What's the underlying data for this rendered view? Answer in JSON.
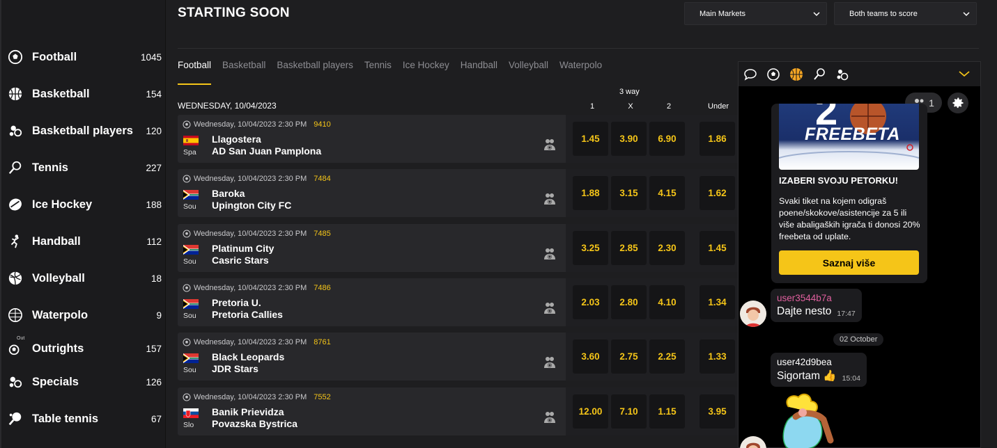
{
  "page": {
    "title": "STARTING SOON"
  },
  "dropdowns": {
    "markets": "Main Markets",
    "submarket": "Both teams to score"
  },
  "sidebar": {
    "items": [
      {
        "label": "Football",
        "count": "1045",
        "icon": "soccer-ball-icon"
      },
      {
        "label": "Basketball",
        "count": "154",
        "icon": "basketball-icon"
      },
      {
        "label": "Basketball players",
        "count": "120",
        "icon": "basketball-players-icon"
      },
      {
        "label": "Tennis",
        "count": "227",
        "icon": "tennis-racket-icon"
      },
      {
        "label": "Ice Hockey",
        "count": "188",
        "icon": "hockey-puck-icon"
      },
      {
        "label": "Handball",
        "count": "112",
        "icon": "handball-player-icon"
      },
      {
        "label": "Volleyball",
        "count": "18",
        "icon": "volleyball-icon"
      },
      {
        "label": "Waterpolo",
        "count": "9",
        "icon": "waterpolo-ball-icon"
      },
      {
        "label": "Outrights",
        "count": "157",
        "icon": "outrights-icon",
        "badge": "Out"
      },
      {
        "label": "Specials",
        "count": "126",
        "icon": "specials-icon"
      },
      {
        "label": "Table tennis",
        "count": "67",
        "icon": "table-tennis-icon"
      }
    ]
  },
  "tabs": [
    "Football",
    "Basketball",
    "Basketball players",
    "Tennis",
    "Ice Hockey",
    "Handball",
    "Volleyball",
    "Waterpolo"
  ],
  "table": {
    "date_header": "WEDNESDAY, 10/04/2023",
    "group_header": "3 way",
    "columns": [
      "1",
      "X",
      "2",
      "Under"
    ]
  },
  "matches": [
    {
      "datetime": "Wednesday, 10/04/2023 2:30 PM",
      "id": "9410",
      "country": "Spa",
      "flag": "spain",
      "team1": "Llagostera",
      "team2": "AD San Juan Pamplona",
      "odds": [
        "1.45",
        "3.90",
        "6.90",
        "1.86"
      ]
    },
    {
      "datetime": "Wednesday, 10/04/2023 2:30 PM",
      "id": "7484",
      "country": "Sou",
      "flag": "south-africa",
      "team1": "Baroka",
      "team2": "Upington City FC",
      "odds": [
        "1.88",
        "3.15",
        "4.15",
        "1.62"
      ]
    },
    {
      "datetime": "Wednesday, 10/04/2023 2:30 PM",
      "id": "7485",
      "country": "Sou",
      "flag": "south-africa",
      "team1": "Platinum City",
      "team2": "Casric Stars",
      "odds": [
        "3.25",
        "2.85",
        "2.30",
        "1.45"
      ]
    },
    {
      "datetime": "Wednesday, 10/04/2023 2:30 PM",
      "id": "7486",
      "country": "Sou",
      "flag": "south-africa",
      "team1": "Pretoria U.",
      "team2": "Pretoria Callies",
      "odds": [
        "2.03",
        "2.80",
        "4.10",
        "1.34"
      ]
    },
    {
      "datetime": "Wednesday, 10/04/2023 2:30 PM",
      "id": "8761",
      "country": "Sou",
      "flag": "south-africa",
      "team1": "Black Leopards",
      "team2": "JDR Stars",
      "odds": [
        "3.60",
        "2.75",
        "2.25",
        "1.33"
      ]
    },
    {
      "datetime": "Wednesday, 10/04/2023 2:30 PM",
      "id": "7552",
      "country": "Slo",
      "flag": "slovakia",
      "team1": "Banik Prievidza",
      "team2": "Povazska Bystrica",
      "odds": [
        "12.00",
        "7.10",
        "1.15",
        "3.95"
      ]
    }
  ],
  "chat": {
    "toolbar_icons": [
      "chat-bubble-icon",
      "soccer-ball-icon",
      "basketball-icon",
      "tennis-racket-icon",
      "basketball-players-icon"
    ],
    "members": "1",
    "promo": {
      "image_text": "FREEBETA",
      "title": "IZABERI SVOJU PETORKU!",
      "text": "Svaki tiket na kojem odigraš poene/skokove/asistencije za 5 ili više abaligaških igrača ti donosi 20% freebeta od uplate.",
      "button": "Saznaj više"
    },
    "messages": [
      {
        "user": "user3544b7a",
        "text": "Dajte nesto",
        "time": "17:47"
      },
      {
        "user": "user42d9bea",
        "text": "Sigortam 👍",
        "time": "15:04"
      }
    ],
    "date_separator": "02 October"
  },
  "colors": {
    "accent": "#f5c518",
    "background": "#1e1e20",
    "row": "#28282b",
    "username_pink": "#e0609f"
  }
}
